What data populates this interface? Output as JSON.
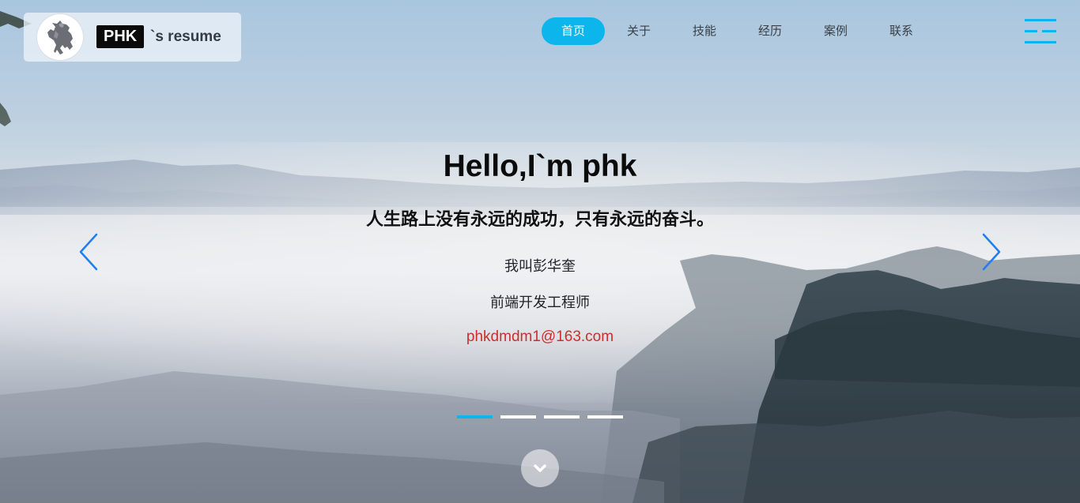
{
  "logo": {
    "badge": "PHK",
    "suffix": "`s resume",
    "avatar_icon": "prancing-horse-icon"
  },
  "nav": {
    "items": [
      {
        "label": "首页",
        "active": true
      },
      {
        "label": "关于",
        "active": false
      },
      {
        "label": "技能",
        "active": false
      },
      {
        "label": "经历",
        "active": false
      },
      {
        "label": "案例",
        "active": false
      },
      {
        "label": "联系",
        "active": false
      }
    ],
    "menu_icon": "hamburger-menu-icon"
  },
  "hero": {
    "title": "Hello,I`m phk",
    "motto": "人生路上没有永远的成功，只有永远的奋斗。",
    "name": "我叫彭华奎",
    "role": "前端开发工程师",
    "email": "phkdmdm1@163.com"
  },
  "carousel": {
    "prev_icon": "chevron-left-icon",
    "next_icon": "chevron-right-icon",
    "slide_count": 4,
    "active_index": 0,
    "scroll_icon": "chevron-down-icon"
  },
  "colors": {
    "accent": "#0cb5ec",
    "arrow": "#1f7ef0",
    "email": "#c9302c",
    "title": "#0b0b0b"
  }
}
